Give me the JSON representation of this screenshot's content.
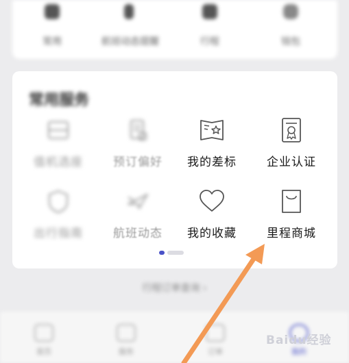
{
  "top_row": {
    "items": [
      {
        "label": "常用"
      },
      {
        "label": "航班动态提醒"
      },
      {
        "label": "行程"
      },
      {
        "label": "钱包"
      }
    ]
  },
  "services": {
    "title": "常用服务",
    "items": [
      {
        "label": "值机选座",
        "icon": "seat-icon"
      },
      {
        "label": "预订偏好",
        "icon": "document-icon"
      },
      {
        "label": "我的差标",
        "icon": "star-book-icon"
      },
      {
        "label": "企业认证",
        "icon": "certificate-icon"
      },
      {
        "label": "出行指南",
        "icon": "shield-icon"
      },
      {
        "label": "航班动态",
        "icon": "plane-icon"
      },
      {
        "label": "我的收藏",
        "icon": "heart-icon"
      },
      {
        "label": "里程商城",
        "icon": "shopping-bag-icon"
      }
    ],
    "pager": {
      "pages": 2,
      "active": 1
    }
  },
  "bottom_link": "行程订单查询 ›",
  "bottom_nav": {
    "items": [
      {
        "label": "首页"
      },
      {
        "label": "服务"
      },
      {
        "label": "订单"
      },
      {
        "label": "我的"
      }
    ]
  },
  "watermark": "Baidu经验",
  "colors": {
    "accent": "#4a52c8",
    "arrow": "#f39a55",
    "background": "#ececee"
  }
}
